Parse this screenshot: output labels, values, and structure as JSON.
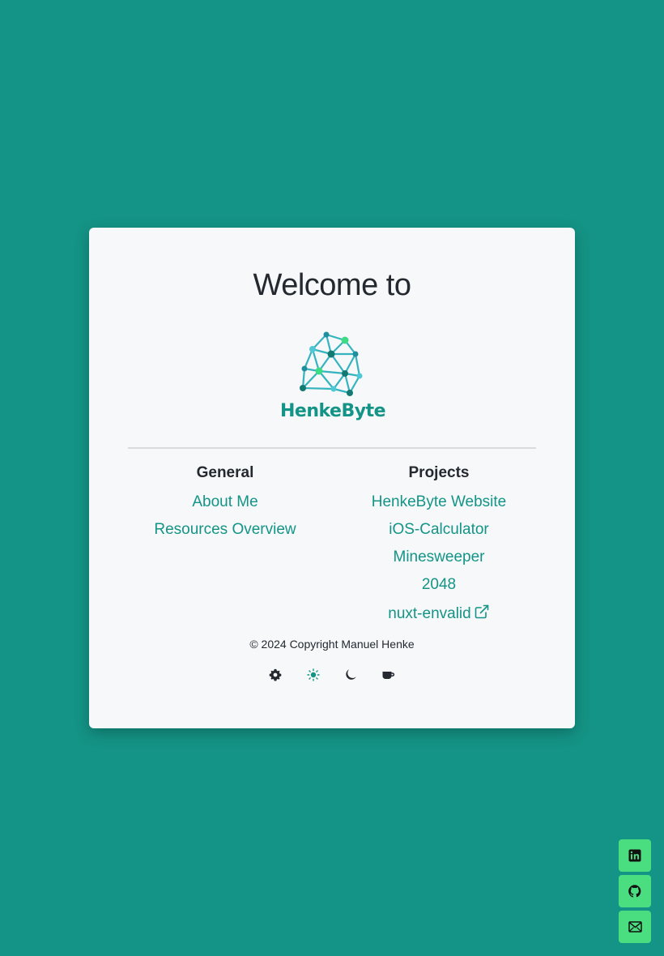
{
  "card": {
    "title": "Welcome to",
    "logo_text": "HenkeByte"
  },
  "general": {
    "heading": "General",
    "links": [
      "About Me",
      "Resources Overview"
    ]
  },
  "projects": {
    "heading": "Projects",
    "links": [
      "HenkeByte Website",
      "iOS-Calculator",
      "Minesweeper",
      "2048",
      "nuxt-envalid"
    ]
  },
  "footer": {
    "copyright": "© 2024 Copyright Manuel Henke"
  },
  "theme_buttons": [
    "gear-icon",
    "sun-icon",
    "moon-icon",
    "coffee-icon"
  ],
  "social_links": [
    "linkedin-icon",
    "github-icon",
    "mail-icon"
  ],
  "colors": {
    "background": "#149486",
    "card": "#f6f8fa",
    "accent": "#149486",
    "social_button": "#4ade80",
    "logo_highlight": "#3ddc84"
  }
}
